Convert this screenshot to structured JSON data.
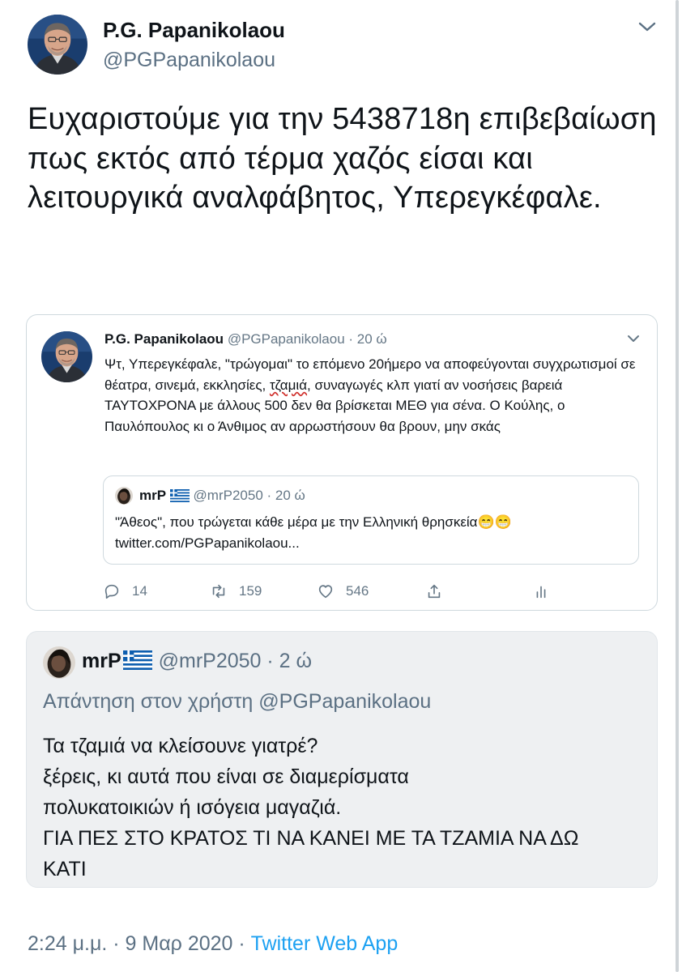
{
  "tweet": {
    "author_name": "P.G. Papanikolaou",
    "author_handle": "@PGPapanikolaou",
    "text": "Ευχαριστούμε για την 5438718η επιβεβαίωση πως εκτός από τέρμα χαζός είσαι και λειτουργικά αναλφάβητος, Υπερεγκέφαλε.",
    "timestamp": "2:24 μ.μ. · 9 Μαρ 2020 · ",
    "source_app": "Twitter Web App"
  },
  "screenshot": {
    "author_name": "P.G. Papanikolaou",
    "author_handle": "@PGPapanikolaou",
    "time": " · 20 ώ",
    "text_part1": "Ψτ, Υπερεγκέφαλε, \"τρώγομαι\" το επόμενο 20ήμερο να αποφεύγονται συγχρωτισμοί σε θέατρα, σινεμά, εκκλησίες, ",
    "text_highlight": "τζαμιά",
    "text_part2": ", συναγωγές κλπ γιατί αν νοσήσεις βαρειά ΤΑΥΤΟΧΡΟΝΑ με άλλους 500 δεν θα βρίσκεται ΜΕΘ για σένα. Ο Κούλης, ο Παυλόπουλος κι ο Άνθιμος αν αρρωστήσουν θα βρουν, μην σκάς",
    "quoted": {
      "author_name": "mrP",
      "author_handle": "@mrP2050",
      "time": " · 20 ώ",
      "text_line1": "\"Άθεος\", που τρώγεται κάθε μέρα με την Ελληνική θρησκεία😁😁",
      "text_line2": "twitter.com/PGPapanikolaou..."
    },
    "actions": {
      "replies": "14",
      "retweets": "159",
      "likes": "546"
    }
  },
  "reply": {
    "author_name": "mrP",
    "author_handle": "@mrP2050",
    "time": " · 2 ώ",
    "replying_to": "Απάντηση στον χρήστη @PGPapanikolaou",
    "text_lines": [
      "Τα τζαμιά να κλείσουνε γιατρέ?",
      "ξέρεις, κι αυτά που είναι σε διαμερίσματα",
      "πολυκατοικιών ή ισόγεια μαγαζιά.",
      "ΓΙΑ ΠΕΣ ΣΤΟ ΚΡΑΤΟΣ ΤΙ ΝΑ ΚΑΝΕΙ ΜΕ ΤΑ ΤΖΑΜΙΑ ΝΑ ΔΩ",
      "ΚΑΤΙ"
    ]
  },
  "icons": {
    "chevron": "chevron-down-icon",
    "reply": "reply-icon",
    "retweet": "retweet-icon",
    "like": "heart-icon",
    "share": "share-icon",
    "analytics": "analytics-icon",
    "flag": "greek-flag-icon"
  },
  "colors": {
    "accent": "#1da1f2",
    "secondary_text": "#5b7083",
    "card_bg": "#eef0f2",
    "spellcheck_underline": "#d0312d"
  }
}
